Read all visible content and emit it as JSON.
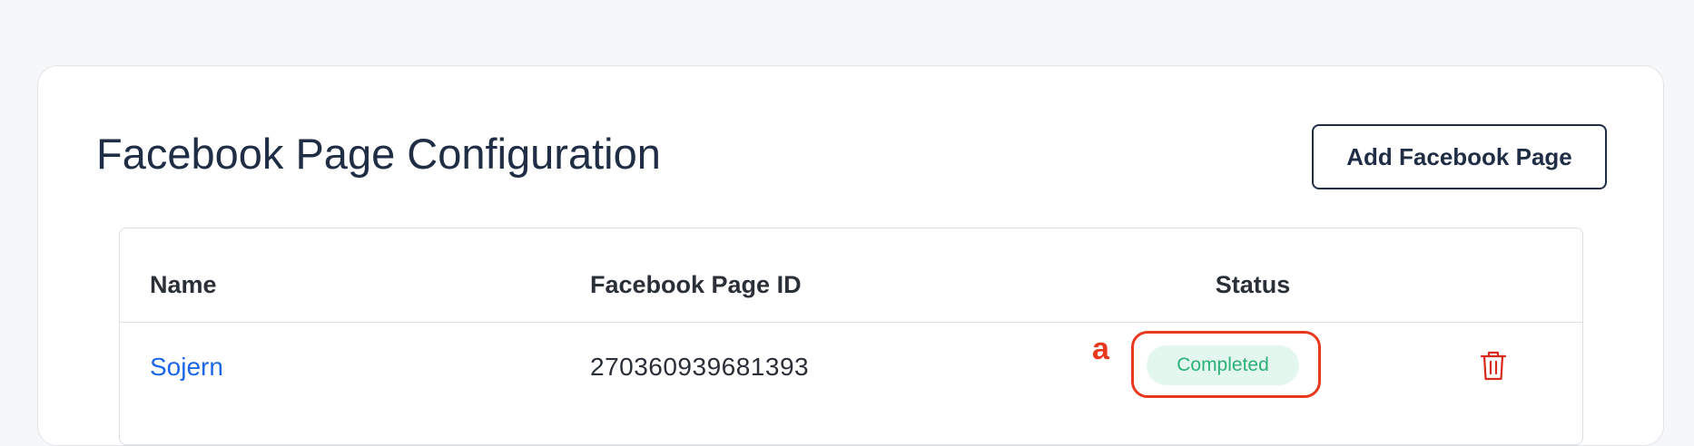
{
  "header": {
    "title": "Facebook Page Configuration",
    "add_button_label": "Add Facebook Page"
  },
  "table": {
    "columns": [
      "Name",
      "Facebook Page ID",
      "Status"
    ],
    "rows": [
      {
        "name": "Sojern",
        "page_id": "270360939681393",
        "status": "Completed"
      }
    ]
  },
  "annotation": {
    "label": "a",
    "color": "#e8391e"
  },
  "colors": {
    "link": "#1c66e8",
    "status_text": "#2bb177",
    "status_bg": "#e3f7ef",
    "delete_icon": "#d9281c",
    "title": "#1f2d45"
  },
  "icons": {
    "delete": "trash-icon"
  }
}
